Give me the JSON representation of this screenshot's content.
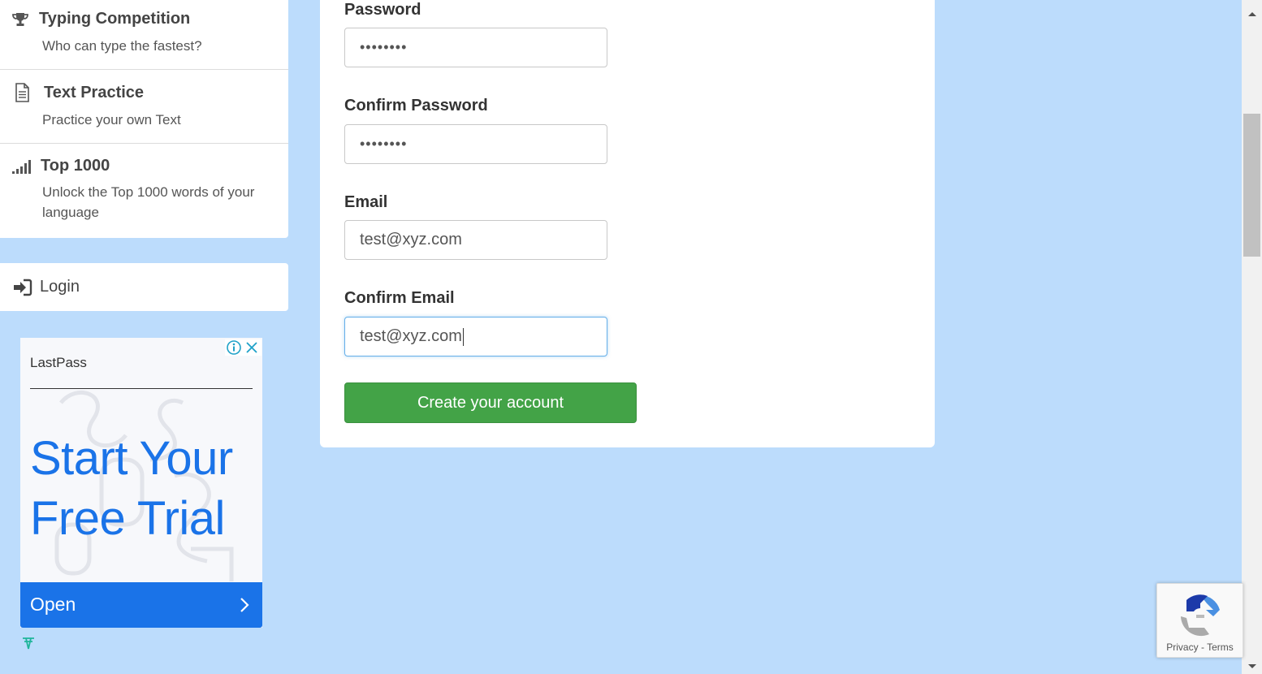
{
  "nav": {
    "items": [
      {
        "title": "Typing Competition",
        "desc": "Who can type the fastest?",
        "icon": "trophy-icon"
      },
      {
        "title": "Text Practice",
        "desc": "Practice your own Text",
        "icon": "document-icon"
      },
      {
        "title": "Top 1000",
        "desc": "Unlock the Top 1000 words of your language",
        "icon": "signal-bars-icon"
      }
    ],
    "login": {
      "label": "Login",
      "icon": "sign-in-icon"
    }
  },
  "ad": {
    "brand": "LastPass",
    "headline": "Start Your Free Trial",
    "cta": "Open",
    "accent": "#1a73e8"
  },
  "form": {
    "password_label": "Password",
    "password_value": "••••••••",
    "confirm_password_label": "Confirm Password",
    "confirm_password_value": "••••••••",
    "email_label": "Email",
    "email_value": "test@xyz.com",
    "confirm_email_label": "Confirm Email",
    "confirm_email_value": "test@xyz.com",
    "submit_label": "Create your account",
    "submit_color": "#43a347"
  },
  "recaptcha": {
    "privacy": "Privacy",
    "separator": " - ",
    "terms": "Terms"
  },
  "colors": {
    "page_background": "#bcdcfc"
  }
}
